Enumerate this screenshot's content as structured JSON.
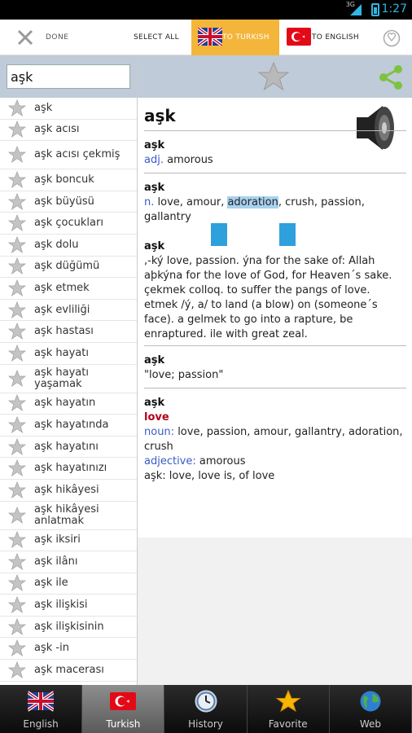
{
  "status": {
    "time": "1:27",
    "signal_label": "3G"
  },
  "actionbar": {
    "done_label": "DONE",
    "select_all_label": "SELECT ALL",
    "to_turkish_label": "TO TURKISH",
    "to_english_label": "TO ENGLISH",
    "accent_color": "#f3b63b"
  },
  "search": {
    "value": "aşk"
  },
  "wordlist": [
    "aşk",
    "aşk acısı",
    "aşk acısı çekmiş",
    "aşk boncuk",
    "aşk büyüsü",
    "aşk çocukları",
    "aşk dolu",
    "aşk düğümü",
    "aşk etmek",
    "aşk evliliği",
    "aşk hastası",
    "aşk hayatı",
    "aşk hayatı yaşamak",
    "aşk hayatın",
    "aşk hayatında",
    "aşk hayatını",
    "aşk hayatınızı",
    "aşk hikâyesi",
    "aşk hikâyesi anlatmak",
    "aşk iksiri",
    "aşk ilânı",
    "aşk ile",
    "aşk ilişkisi",
    "aşk ilişkisinin",
    "aşk -in",
    "aşk macerası"
  ],
  "detail": {
    "headword": "aşk",
    "entries": [
      {
        "head": "aşk",
        "pos": "adj.",
        "text": " amorous"
      },
      {
        "head": "aşk",
        "pos": "n.",
        "pre": " love, amour, ",
        "highlight": "adoration",
        "post": ", crush, passion, gallantry"
      },
      {
        "head": "aşk",
        "text": ",-ký love, passion. ýna for the sake of: Allah aþkýna for the love of God, for Heaven´s sake. çekmek colloq. to suffer the pangs of love. etmek /ý, a/ to land (a blow) on (someone´s face). a gelmek to go into a rapture, be enraptured.  ile with great zeal."
      },
      {
        "head": "aşk",
        "text": "\"love; passion\""
      },
      {
        "head": "aşk",
        "love": "love",
        "noun_label": "noun:",
        "noun_text": " love, passion, amour, gallantry, adoration, crush",
        "adj_label": "adjective:",
        "adj_text": " amorous",
        "extra": "aşk: love, love is, of love"
      }
    ]
  },
  "tabs": [
    {
      "label": "English",
      "icon": "uk-flag-icon"
    },
    {
      "label": "Turkish",
      "icon": "turkey-flag-icon",
      "active": true
    },
    {
      "label": "History",
      "icon": "clock-icon"
    },
    {
      "label": "Favorite",
      "icon": "star-icon"
    },
    {
      "label": "Web",
      "icon": "globe-icon"
    }
  ]
}
